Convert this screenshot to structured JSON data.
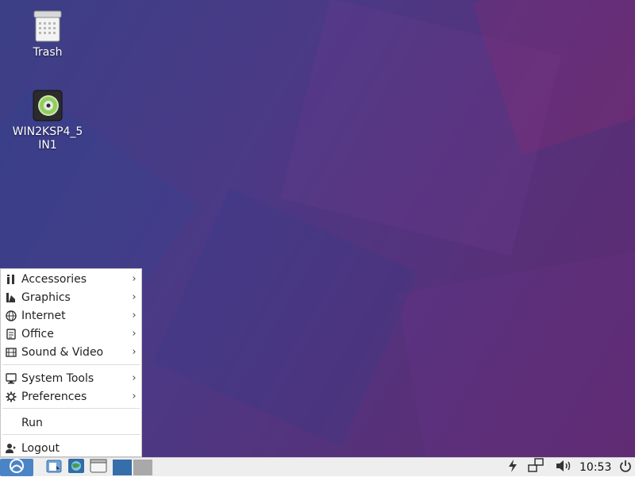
{
  "desktop": {
    "icons": [
      {
        "label": "Trash",
        "icon": "trash-icon"
      },
      {
        "label": "WIN2KSP4_5IN1",
        "icon": "cd-drive-icon"
      }
    ]
  },
  "menu": {
    "items": [
      {
        "label": "Accessories",
        "icon": "accessories-icon",
        "submenu": true
      },
      {
        "label": "Graphics",
        "icon": "graphics-icon",
        "submenu": true
      },
      {
        "label": "Internet",
        "icon": "globe-icon",
        "submenu": true
      },
      {
        "label": "Office",
        "icon": "office-icon",
        "submenu": true
      },
      {
        "label": "Sound & Video",
        "icon": "film-icon",
        "submenu": true
      },
      {
        "label": "System Tools",
        "icon": "monitor-icon",
        "submenu": true
      },
      {
        "label": "Preferences",
        "icon": "gear-icon",
        "submenu": true
      },
      {
        "label": "Run",
        "icon": "",
        "submenu": false
      },
      {
        "label": "Logout",
        "icon": "logout-icon",
        "submenu": false
      }
    ],
    "arrow": "›"
  },
  "taskbar": {
    "launchers": [
      "file-manager-icon",
      "browser-icon",
      "window-icon"
    ],
    "workspaces": [
      {
        "name": "workspace-1",
        "active": true
      },
      {
        "name": "workspace-2",
        "active": false
      }
    ],
    "tray": [
      "power-plug-icon",
      "network-icon",
      "volume-icon"
    ],
    "clock": "10:53"
  },
  "colors": {
    "desktop_bg": "#4a3a86",
    "taskbar_bg": "#eeeeee",
    "start_button": "#4b84c6",
    "active_workspace": "#356ea8"
  }
}
